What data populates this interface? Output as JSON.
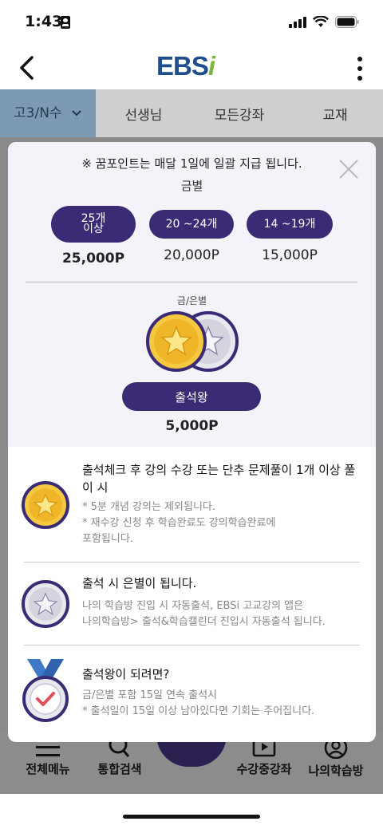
{
  "status_bar": {
    "time": "1:43"
  },
  "header": {
    "logo_main": "EBS",
    "logo_accent": "i"
  },
  "nav": {
    "tabs": [
      {
        "label": "고3/N수"
      },
      {
        "label": "선생님"
      },
      {
        "label": "모든강좌"
      },
      {
        "label": "교재"
      }
    ]
  },
  "bottom_nav": {
    "items": [
      {
        "label": "전체메뉴"
      },
      {
        "label": "통합검색"
      },
      {
        "label": "수강중강좌"
      },
      {
        "label": "나의학습방"
      }
    ]
  },
  "modal": {
    "notice": "※ 꿈포인트는 매달 1일에 일괄 지급 됩니다.",
    "grade_title": "금별",
    "tiers": [
      {
        "label_line1": "25개",
        "label_line2": "이상",
        "points": "25,000P"
      },
      {
        "label": "20 ~24개",
        "points": "20,000P"
      },
      {
        "label": "14 ~19개",
        "points": "15,000P"
      }
    ],
    "gold_silver_label": "금/은별",
    "attendance_king_label": "출석왕",
    "attendance_king_points": "5,000P",
    "rules": [
      {
        "icon": "gold-star-medal-icon",
        "title": "출석체크 후 강의 수강 또는 단추 문제풀이 1개 이상 풀이 시",
        "desc_lines": [
          "* 5분 개념 강의는 제외됩니다.",
          "* 재수강 신청 후 학습완료도 강의학습완료에",
          "포함됩니다."
        ]
      },
      {
        "icon": "silver-star-medal-icon",
        "title": "출석 시 은별이 됩니다.",
        "desc_lines": [
          "나의 학습방 진입 시 자동출석, EBSi 고교강의 앱은",
          "나의학습방> 출석&학습캘린더 진입시 자동출석 됩니다."
        ]
      },
      {
        "icon": "ribbon-medal-check-icon",
        "title": "출석왕이 되려면?",
        "desc_lines": [
          "금/은별 포함 15일 연속 출석시",
          "* 출석일이 15일 이상 남아있다면 기회는 주어집니다."
        ]
      }
    ]
  },
  "colors": {
    "primary_purple": "#3b2b75",
    "gold": "#f5c842",
    "silver": "#e6e6ee",
    "logo_blue": "#1f4e8c",
    "logo_green": "#7cb342"
  }
}
